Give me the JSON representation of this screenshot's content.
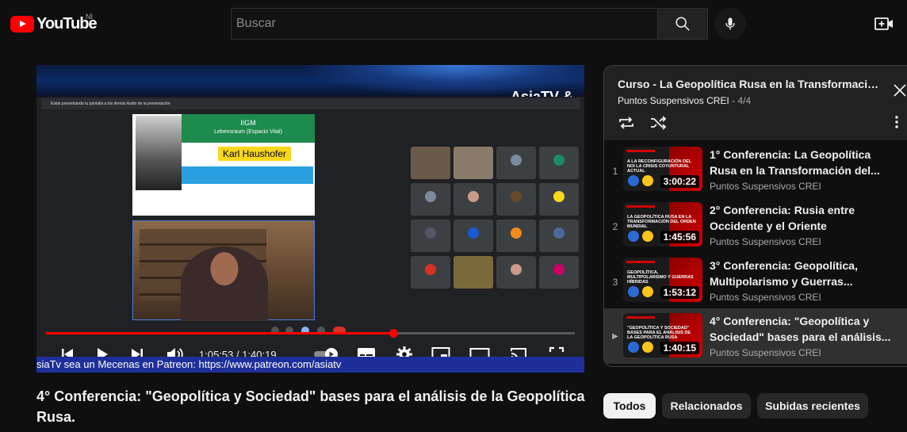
{
  "header": {
    "logo_text": "YouTube",
    "country_code": "NI",
    "search_placeholder": "Buscar"
  },
  "player": {
    "brand_overlay": "AsiaTV &",
    "current_time": "1:05:53",
    "duration": "1:40:19",
    "time_separator": " / ",
    "progress_fraction": 0.657,
    "ticker_text": "siaTv sea un Mecenas en Patreon: https://www.patreon.com/asiatv",
    "meet_bar_text": "Estás presentando tu pantalla a los demás     Audio de la presentación",
    "slide": {
      "heading": "IIGM",
      "subheading": "Lebensraum (Espacio Vital)",
      "name": "Karl Haushofer"
    }
  },
  "video_title": "4° Conferencia: \"Geopolítica y Sociedad\" bases para el análisis de la Geopolítica Rusa.",
  "playlist": {
    "title": "Curso - La Geopolítica Rusa en la Transformación ...",
    "channel": "Puntos Suspensivos CREI",
    "position": "4/4",
    "items": [
      {
        "index": "1",
        "title": "1° Conferencia: La Geopolítica Rusa en la Transformación del...",
        "channel": "Puntos Suspensivos CREI",
        "duration": "3:00:22",
        "thumb_text": "A LA RECONFIGURACIÓN DEL NOI LA CRISIS COYUNTURAL ACTUAL"
      },
      {
        "index": "2",
        "title": "2° Conferencia: Rusia entre Occidente y el Oriente",
        "channel": "Puntos Suspensivos CREI",
        "duration": "1:45:56",
        "thumb_text": "LA GEOPOLÍTICA RUSA EN LA TRANSFORMACIÓN DEL ORDEN MUNDIAL"
      },
      {
        "index": "3",
        "title": "3° Conferencia: Geopolítica, Multipolarismo y Guerras...",
        "channel": "Puntos Suspensivos CREI",
        "duration": "1:53:12",
        "thumb_text": "GEOPOLÍTICA, MULTIPOLARISMO Y GUERRAS HÍBRIDAS"
      },
      {
        "index": "▶",
        "title": "4° Conferencia: \"Geopolítica y Sociedad\" bases para el análisis...",
        "channel": "Puntos Suspensivos CREI",
        "duration": "1:40:15",
        "thumb_text": "\"GEOPOLÍTICA Y SOCIEDAD\" BASES PARA EL ANÁLISIS DE LA GEOPOLÍTICA RUSA"
      }
    ]
  },
  "chips": [
    "Todos",
    "Relacionados",
    "Subidas recientes"
  ],
  "colors": {
    "background": "#0f0f0f",
    "accent_red": "#ff0000",
    "chip_active": "#f1f1f1",
    "chip_inactive": "#272727"
  }
}
